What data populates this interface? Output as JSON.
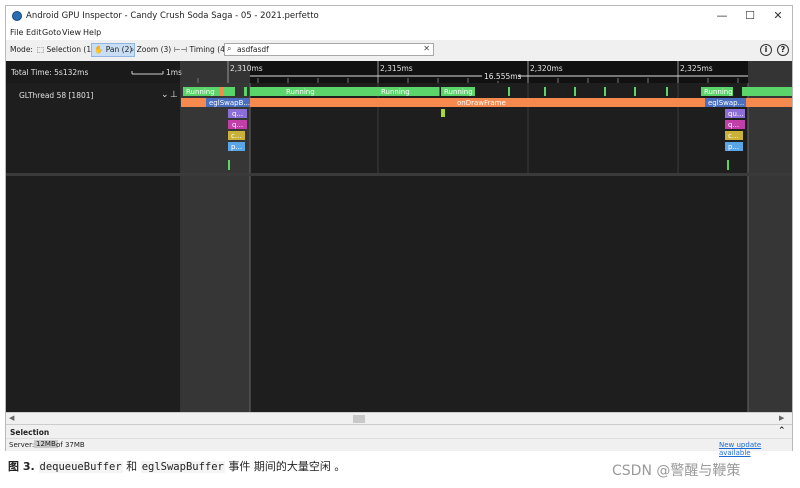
{
  "window": {
    "title": "Android GPU Inspector - Candy Crush Soda Saga - 05 - 2021.perfetto",
    "controls": {
      "minimize": "—",
      "maximize": "☐",
      "close": "✕"
    }
  },
  "menu": [
    "File",
    "Edit",
    "Goto",
    "View",
    "Help"
  ],
  "toolbar": {
    "mode_label": "Mode:",
    "modes": [
      {
        "label": "Selection (1)",
        "active": false
      },
      {
        "label": "Pan (2)",
        "active": true
      },
      {
        "label": "Zoom (3)",
        "active": false
      },
      {
        "label": "Timing (4)",
        "active": false
      }
    ],
    "search_value": "asdfasdf",
    "info_icon": "i",
    "help_icon": "?"
  },
  "timeline": {
    "total_time": "Total Time: 5s132ms",
    "scale_label": "1ms",
    "ticks": [
      "2,310ms",
      "2,315ms",
      "2,320ms",
      "2,325ms"
    ],
    "measure_label": "16.555ms"
  },
  "track": {
    "name": "GLThread 58 [1801]",
    "running_label": "Running",
    "eglswap_short": "eglSwapB...",
    "eglswap_short2": "eglSwap...",
    "ondrawframe": "onDrawFrame",
    "q1": "qu...",
    "q2": "q...",
    "c": "c...",
    "p": "p..."
  },
  "selection_title": "Selection",
  "status": {
    "server_prefix": "Server:",
    "server_used": "12MB",
    "server_suffix": "of 37MB",
    "update": "New update available"
  },
  "caption": {
    "prefix": "图 3. ",
    "code1": "dequeueBuffer",
    "mid": " 和 ",
    "code2": "eglSwapBuffer",
    "suffix": " 事件 期间的大量空闲 。"
  },
  "watermark": "CSDN @警醒与鞭策",
  "colors": {
    "running": "#5bd46a",
    "eglswap": "#4a6fc0",
    "ondrawframe": "#f5894e",
    "qu_purple": "#8b6fd6",
    "q_magenta": "#c23ea8",
    "c_yellow": "#c9b13a",
    "p_blue": "#5aa5e6",
    "link": "#1a6ad8"
  }
}
